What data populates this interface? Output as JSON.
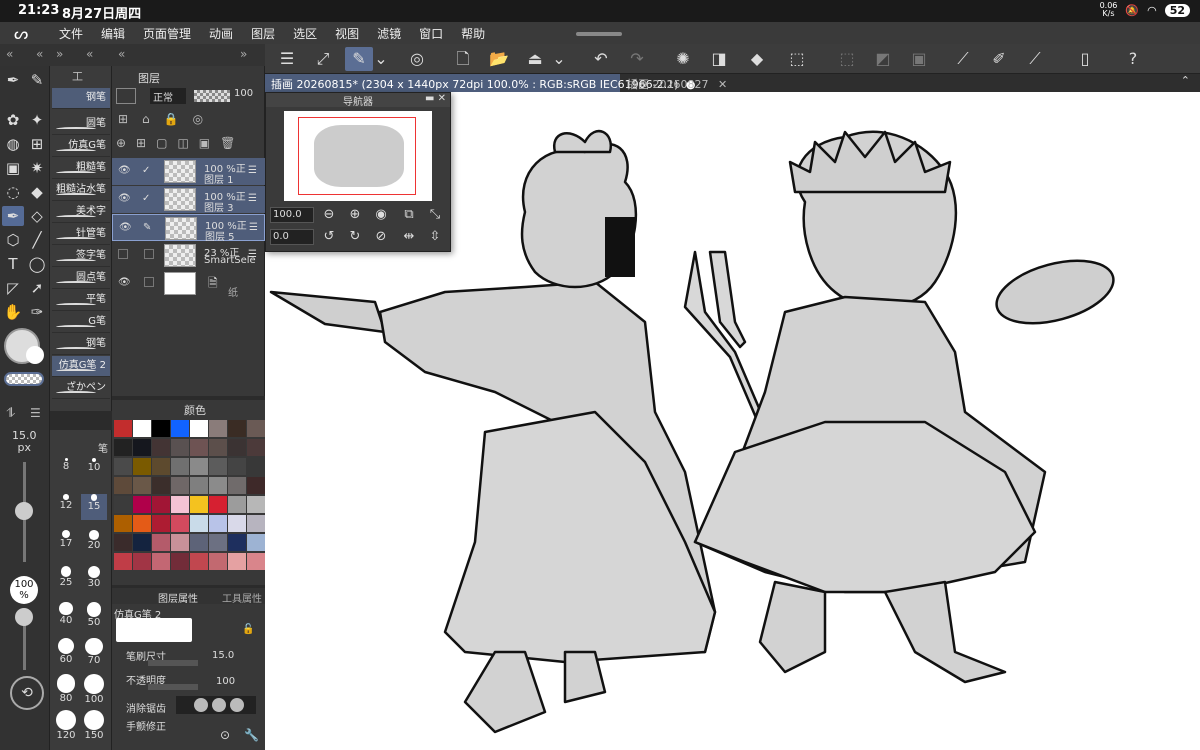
{
  "statusbar": {
    "time": "21:23",
    "date": "8月27日周四",
    "net": "0.06\nK/s",
    "battery": "52"
  },
  "menu": [
    "文件",
    "编辑",
    "页面管理",
    "动画",
    "图层",
    "选区",
    "视图",
    "滤镜",
    "窗口",
    "帮助"
  ],
  "tabs": [
    {
      "label": "插画 20260815* (2304 x 1440px 72dpi 100.0% : RGB:sRGB IEC61966-2.1)",
      "close": "●"
    },
    {
      "label": "插画 20260827",
      "close": "✕"
    }
  ],
  "subtool": {
    "header": "工",
    "items": [
      "钢笔",
      "圆笔",
      "仿真G笔",
      "粗糙笔",
      "粗糙沾水笔",
      "美术字",
      "针管笔",
      "签字笔",
      "圆点笔",
      "平笔",
      "G笔",
      "钢笔",
      "仿真G笔 2",
      "ざかペン"
    ]
  },
  "layers": {
    "header": "图层",
    "blend": "正常",
    "opacity": "100",
    "items": [
      {
        "pct": "100 %正",
        "name": "图层 1"
      },
      {
        "pct": "100 %正",
        "name": "图层 3"
      },
      {
        "pct": "100 %正",
        "name": "图层 5"
      },
      {
        "pct": "23 %正",
        "name": "SmartSele"
      },
      {
        "pct": "",
        "name": "纸"
      }
    ]
  },
  "color": {
    "header": "颜色"
  },
  "brushsize": {
    "value": "15.0",
    "unit": "px",
    "header": "笔",
    "opacity": "100",
    "opacity_unit": "%",
    "sizes": [
      "8",
      "10",
      "12",
      "15",
      "17",
      "20",
      "25",
      "30",
      "40",
      "50",
      "60",
      "70",
      "80",
      "100",
      "120",
      "150"
    ]
  },
  "props": {
    "tab1": "图层属性",
    "tab2": "工具属性",
    "tool": "仿真G笔 2",
    "size_label": "笔刷尺寸",
    "size_value": "15.0",
    "opacity_label": "不透明度",
    "opacity_value": "100",
    "aa_label": "消除锯齿",
    "stab_label": "手颤修正"
  },
  "navigator": {
    "title": "导航器",
    "zoom": "100.0",
    "rotate": "0.0"
  },
  "colors": {
    "accent": "#5b6e94",
    "palette": [
      "#c22d2d",
      "#ffffff",
      "#000000",
      "#1163ff",
      "#ffffff",
      "#8a7c7a",
      "#3a2c24",
      "#6a5a55",
      "#222222",
      "#15171e",
      "#433434",
      "#595151",
      "#6e5353",
      "#5c4f4b",
      "#3b3333",
      "#4c3a3a",
      "#4a4a4a",
      "#7a5a00",
      "#5d4a2e",
      "#707070",
      "#8a8a8a",
      "#5c5c5c",
      "#444444",
      "#383838",
      "#5e4a3a",
      "#6a5848",
      "#3b2e2b",
      "#6f6767",
      "#7f7f7f",
      "#8b8b8b",
      "#706b6b",
      "#3e2929",
      "#3b3b3b",
      "#b0004a",
      "#a11535",
      "#f4c3d4",
      "#f4c21f",
      "#d62031",
      "#9c9c9c",
      "#b7b7b7",
      "#ad5f00",
      "#e45b17",
      "#ad1c32",
      "#d34a5e",
      "#c9dbe9",
      "#b8c3e8",
      "#d9d9e9",
      "#b7b4bf",
      "#3a2b2b",
      "#14233f",
      "#b45b6a",
      "#c89199",
      "#5d6378",
      "#6c7082",
      "#1e2f5e",
      "#9db3d3",
      "#c03d47",
      "#a13545",
      "#c36773",
      "#722c39",
      "#c1474f",
      "#c26970",
      "#e5a1a2",
      "#d9858b"
    ]
  }
}
